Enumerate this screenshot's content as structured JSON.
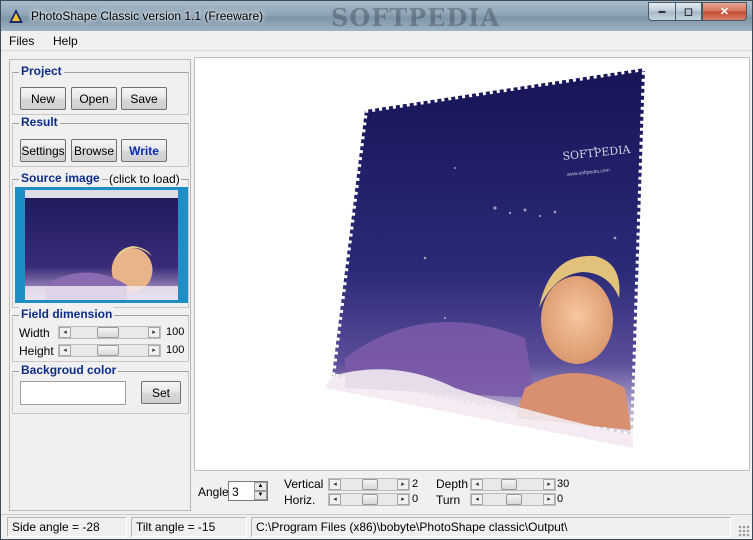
{
  "window": {
    "title": "PhotoShape Classic version 1.1 (Freeware)",
    "watermark": "SOFTPEDIA",
    "icon": "photoshape-app-icon",
    "controls": {
      "minimize": "▬",
      "maximize": "◻",
      "close": "✕"
    }
  },
  "menu": [
    {
      "label": "Files"
    },
    {
      "label": "Help"
    }
  ],
  "project": {
    "title": "Project",
    "new_label": "New",
    "open_label": "Open",
    "save_label": "Save"
  },
  "result": {
    "title": "Result",
    "settings_label": "Settings",
    "browse_label": "Browse",
    "write_label": "Write"
  },
  "source_image": {
    "title": "Source image",
    "hint": "(click to load)"
  },
  "field_dimension": {
    "title": "Field dimension",
    "width_label": "Width",
    "width_value": "100",
    "height_label": "Height",
    "height_value": "100"
  },
  "background_color": {
    "title": "Backgroud color",
    "set_label": "Set"
  },
  "canvas": {
    "watermark_text": "SOFTPEDIA",
    "watermark_sub": "www.softpedia.com"
  },
  "controls": {
    "angle_label": "Angle",
    "angle_value": "3",
    "vertical_label": "Vertical",
    "vertical_value": "2",
    "horiz_label": "Horiz.",
    "horiz_value": "0",
    "depth_label": "Depth",
    "depth_value": "30",
    "turn_label": "Turn",
    "turn_value": "0"
  },
  "status": {
    "side_angle": "Side angle = -28",
    "tilt_angle": "Tilt angle = -15",
    "path": "C:\\Program Files (x86)\\bobyte\\PhotoShape classic\\Output\\"
  },
  "colors": {
    "accent": "#0c2c8c",
    "image_border": "#1e8ec7",
    "canvas_bg": "#ffffff"
  }
}
